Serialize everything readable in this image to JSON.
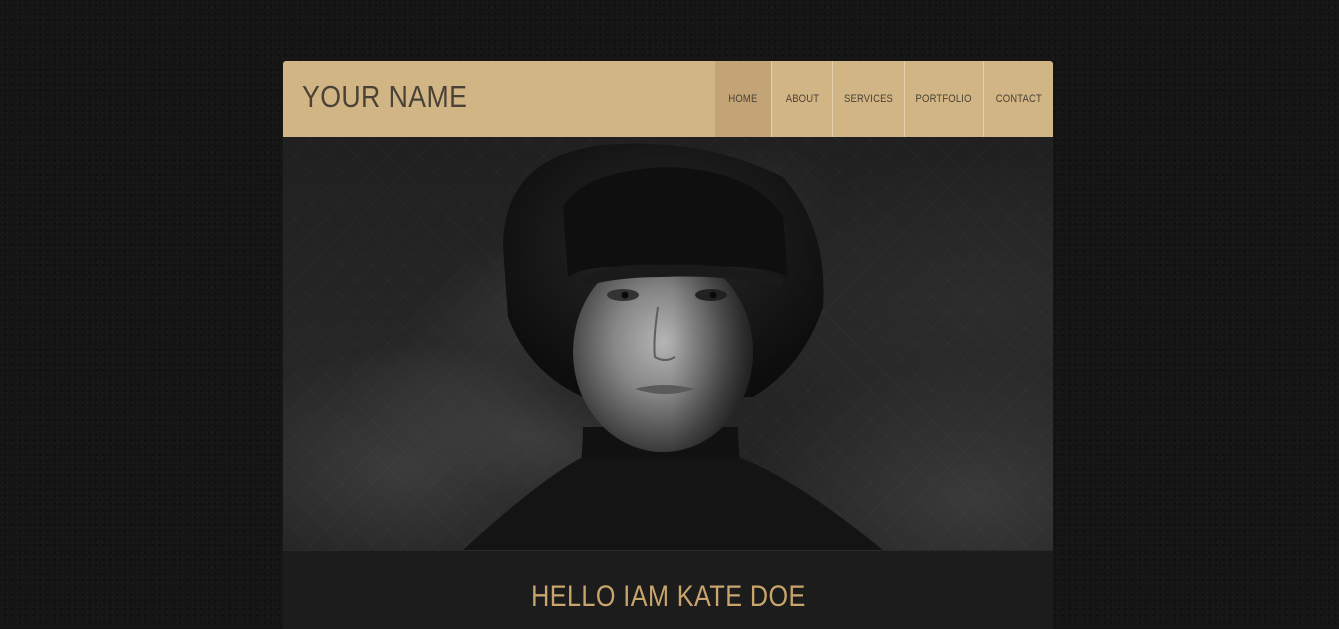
{
  "header": {
    "logo": "YOUR NAME",
    "nav": [
      {
        "label": "HOME",
        "active": true
      },
      {
        "label": "ABOUT",
        "active": false
      },
      {
        "label": "SERVICES",
        "active": false
      },
      {
        "label": "PORTFOLIO",
        "active": false
      },
      {
        "label": "CONTACT",
        "active": false
      }
    ]
  },
  "hero": {
    "image": "portrait-photo"
  },
  "intro": {
    "heading": "HELLO IAM KATE DOE"
  },
  "colors": {
    "header_bg": "#d2b585",
    "nav_active_bg": "#c2a476",
    "text_dark": "#4a4236",
    "heading_accent": "#c9a46d",
    "page_bg": "#151515"
  }
}
